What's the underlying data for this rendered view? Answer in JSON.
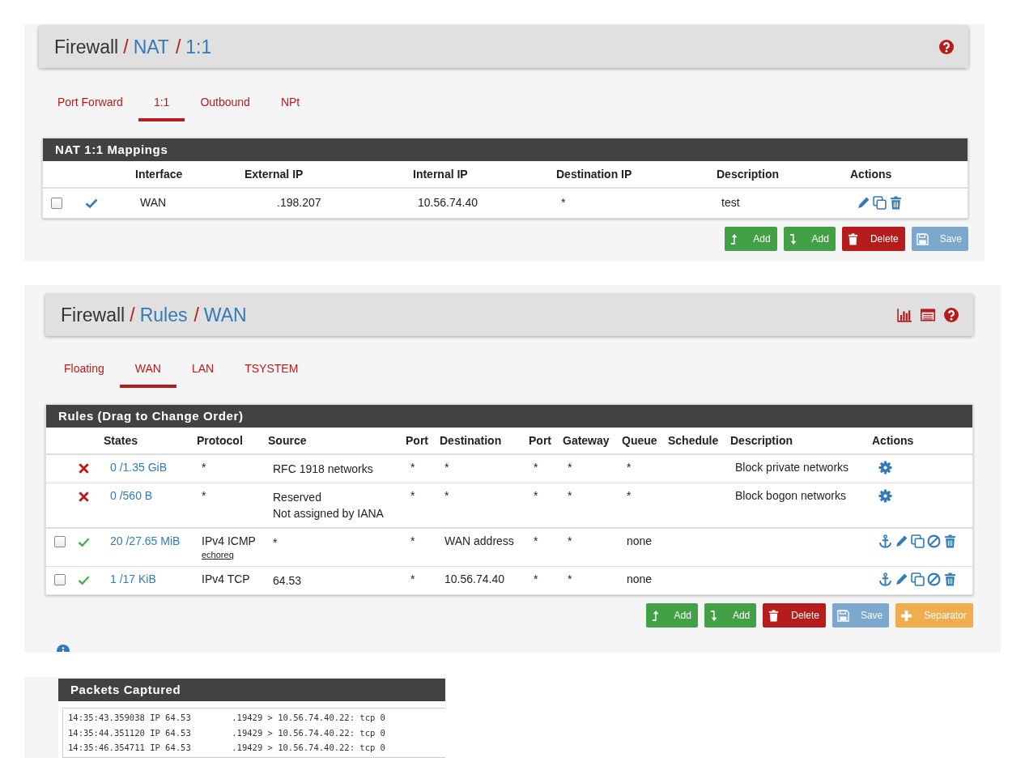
{
  "nat_page": {
    "breadcrumb": {
      "separator": "/",
      "items": [
        {
          "label": "Firewall",
          "link": false
        },
        {
          "label": "NAT",
          "link": true
        },
        {
          "label": "1:1",
          "link": true
        }
      ]
    },
    "tabs": [
      {
        "label": "Port Forward",
        "selected": false
      },
      {
        "label": "1:1",
        "selected": true
      },
      {
        "label": "Outbound",
        "selected": false
      },
      {
        "label": "NPt",
        "selected": false
      }
    ],
    "panel_title": "NAT 1:1 Mappings",
    "columns": [
      "",
      "",
      "Interface",
      "External IP",
      "Internal IP",
      "Destination IP",
      "Description",
      "Actions"
    ],
    "rows": [
      {
        "checked": false,
        "enabled": true,
        "interface": "WAN",
        "external_ip": ".198.207",
        "internal_ip": "10.56.74.40",
        "destination_ip": "*",
        "description": "test"
      }
    ],
    "buttons": [
      {
        "kind": "add-top",
        "label": "Add",
        "disabled": false
      },
      {
        "kind": "add-bottom",
        "label": "Add",
        "disabled": false
      },
      {
        "kind": "delete",
        "label": "Delete",
        "disabled": false
      },
      {
        "kind": "save",
        "label": "Save",
        "disabled": true
      }
    ]
  },
  "rules_page": {
    "breadcrumb": {
      "separator": "/",
      "items": [
        {
          "label": "Firewall",
          "link": false
        },
        {
          "label": "Rules",
          "link": true
        },
        {
          "label": "WAN",
          "link": true
        }
      ]
    },
    "tabs": [
      {
        "label": "Floating",
        "selected": false
      },
      {
        "label": "WAN",
        "selected": true
      },
      {
        "label": "LAN",
        "selected": false
      },
      {
        "label": "TSYSTEM",
        "selected": false
      }
    ],
    "panel_title": "Rules (Drag to Change Order)",
    "columns": [
      "",
      "",
      "States",
      "Protocol",
      "Source",
      "Port",
      "Destination",
      "Port",
      "Gateway",
      "Queue",
      "Schedule",
      "Description",
      "Actions"
    ],
    "rows": [
      {
        "kind": "block",
        "states": "0 /1.35 GiB",
        "protocol": "*",
        "source": [
          "RFC 1918 networks"
        ],
        "source_port": "*",
        "destination": "*",
        "destination_port": "*",
        "gateway": "*",
        "queue": "*",
        "description": "Block private networks"
      },
      {
        "kind": "block",
        "states": "0 /560 B",
        "protocol": "*",
        "source": [
          "Reserved",
          "Not assigned by IANA"
        ],
        "source_port": "*",
        "destination": "*",
        "destination_port": "*",
        "gateway": "*",
        "queue": "*",
        "description": "Block bogon networks"
      },
      {
        "kind": "pass",
        "checked": false,
        "states": "20 /27.65 MiB",
        "protocol": "IPv4 ICMP",
        "protocol_detail": "echoreq",
        "source": [
          "*"
        ],
        "source_port": "*",
        "destination": "WAN address",
        "destination_port": "*",
        "gateway": "*",
        "queue": "none"
      },
      {
        "kind": "pass",
        "checked": false,
        "states": "1 /17 KiB",
        "protocol": "IPv4 TCP",
        "source": [
          "64.53"
        ],
        "source_port": "*",
        "destination": "10.56.74.40",
        "destination_port": "*",
        "gateway": "*",
        "queue": "none"
      }
    ],
    "buttons": [
      {
        "kind": "add-top",
        "label": "Add",
        "disabled": false
      },
      {
        "kind": "add-bottom",
        "label": "Add",
        "disabled": false
      },
      {
        "kind": "delete",
        "label": "Delete",
        "disabled": false
      },
      {
        "kind": "save",
        "label": "Save",
        "disabled": true
      },
      {
        "kind": "separator",
        "label": "Separator",
        "disabled": false
      }
    ]
  },
  "packets": {
    "title": "Packets Captured",
    "lines": [
      "14:35:43.359038 IP 64.53        .19429 > 10.56.74.40.22: tcp 0",
      "14:35:44.351120 IP 64.53        .19429 > 10.56.74.40.22: tcp 0",
      "14:35:46.354711 IP 64.53        .19429 > 10.56.74.40.22: tcp 0"
    ]
  }
}
